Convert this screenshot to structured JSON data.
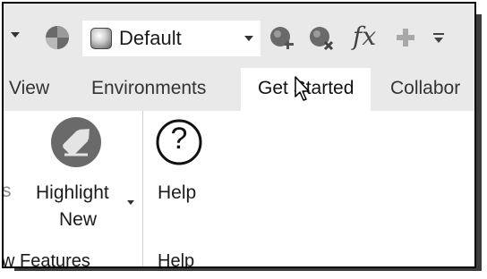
{
  "quick_access_toolbar": {
    "appearance_value": "Default",
    "icons": [
      "dropdown-arrow-icon",
      "material-sphere-icon",
      "appearance-swatch-icon",
      "adjust-appearance-icon",
      "clear-appearance-icon",
      "fx-parameters-icon",
      "plus-icon",
      "customize-toolbar-icon"
    ],
    "fx_label": "fx"
  },
  "tabs": [
    {
      "label": "View",
      "active": false
    },
    {
      "label": "Environments",
      "active": false
    },
    {
      "label": "Get Started",
      "active": true
    },
    {
      "label": "Collabor",
      "active": false
    }
  ],
  "ribbon": {
    "left_edge_fragment": "s",
    "highlight_new": {
      "line1": "Highlight",
      "line2": "New"
    },
    "help_button": {
      "label": "Help",
      "glyph": "?"
    },
    "panels": [
      {
        "label": "w Features"
      },
      {
        "label": "Help"
      }
    ]
  },
  "colors": {
    "toolbar_bg": "#e9e9e9",
    "active_tab_bg": "#ffffff",
    "icon_gray": "#6a6a6a"
  }
}
